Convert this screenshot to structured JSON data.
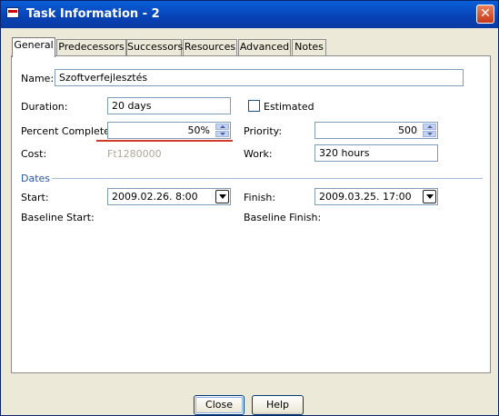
{
  "window": {
    "title": "Task Information - 2",
    "close_symbol": "✕"
  },
  "tabs": [
    {
      "label": "General",
      "active": true
    },
    {
      "label": "Predecessors",
      "active": false
    },
    {
      "label": "Successors",
      "active": false
    },
    {
      "label": "Resources",
      "active": false
    },
    {
      "label": "Advanced",
      "active": false
    },
    {
      "label": "Notes",
      "active": false
    }
  ],
  "form": {
    "name_label": "Name:",
    "name_value": "Szoftverfejlesztés",
    "duration_label": "Duration:",
    "duration_value": "20 days",
    "estimated_label": "Estimated",
    "estimated_checked": false,
    "percent_label": "Percent Complete:",
    "percent_value": "50%",
    "priority_label": "Priority:",
    "priority_value": "500",
    "cost_label": "Cost:",
    "cost_value": "Ft1280000",
    "work_label": "Work:",
    "work_value": "320 hours"
  },
  "dates": {
    "section_label": "Dates",
    "start_label": "Start:",
    "start_value": "2009.02.26. 8:00",
    "finish_label": "Finish:",
    "finish_value": "2009.03.25. 17:00",
    "baseline_start_label": "Baseline Start:",
    "baseline_finish_label": "Baseline Finish:"
  },
  "buttons": {
    "close_label": "Close",
    "help_label": "Help"
  },
  "colors": {
    "titlebar": "#0842b5",
    "section_title": "#2b52a4",
    "error_underline": "#d03a2a"
  }
}
